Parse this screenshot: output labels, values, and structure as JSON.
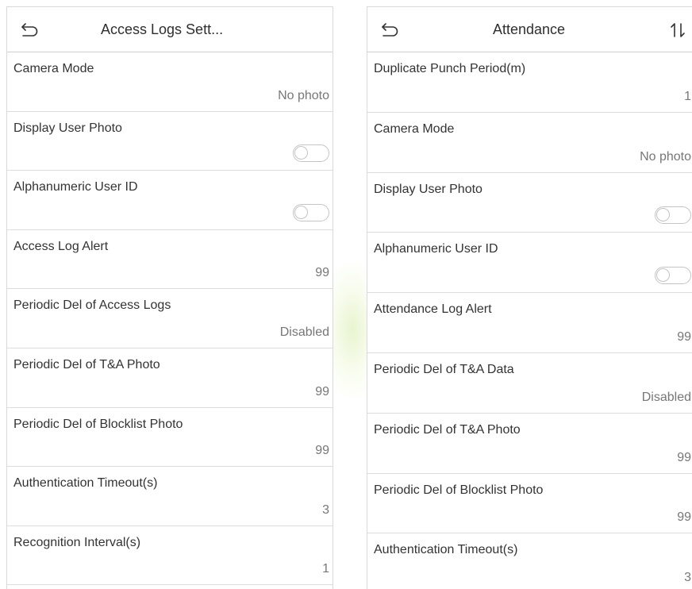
{
  "left_panel": {
    "title": "Access Logs Sett...",
    "back_icon": "back-arrow-icon",
    "rows": [
      {
        "label": "Camera Mode",
        "value": "No photo",
        "type": "value"
      },
      {
        "label": "Display User Photo",
        "type": "toggle",
        "state": "off"
      },
      {
        "label": "Alphanumeric User ID",
        "type": "toggle",
        "state": "off"
      },
      {
        "label": "Access Log Alert",
        "value": "99",
        "type": "value"
      },
      {
        "label": "Periodic Del of Access Logs",
        "value": "Disabled",
        "type": "value"
      },
      {
        "label": "Periodic Del of T&A Photo",
        "value": "99",
        "type": "value"
      },
      {
        "label": "Periodic Del of Blocklist Photo",
        "value": "99",
        "type": "value"
      },
      {
        "label": "Authentication Timeout(s)",
        "value": "3",
        "type": "value"
      },
      {
        "label": "Recognition Interval(s)",
        "value": "1",
        "type": "value"
      }
    ]
  },
  "right_panel": {
    "title": "Attendance",
    "back_icon": "back-arrow-icon",
    "sort_icon": "sort-icon",
    "rows": [
      {
        "label": "Duplicate Punch Period(m)",
        "value": "1",
        "type": "value"
      },
      {
        "label": "Camera Mode",
        "value": "No photo",
        "type": "value"
      },
      {
        "label": "Display User Photo",
        "type": "toggle",
        "state": "off"
      },
      {
        "label": "Alphanumeric User ID",
        "type": "toggle",
        "state": "off"
      },
      {
        "label": "Attendance Log Alert",
        "value": "99",
        "type": "value"
      },
      {
        "label": "Periodic Del of T&A Data",
        "value": "Disabled",
        "type": "value"
      },
      {
        "label": "Periodic Del of T&A Photo",
        "value": "99",
        "type": "value"
      },
      {
        "label": "Periodic Del of Blocklist Photo",
        "value": "99",
        "type": "value"
      },
      {
        "label": "Authentication Timeout(s)",
        "value": "3",
        "type": "value"
      }
    ]
  },
  "colors": {
    "divider": "#dcdcdc",
    "label": "#333333",
    "value": "#777777",
    "toggle_off": "#c4c4c4"
  }
}
